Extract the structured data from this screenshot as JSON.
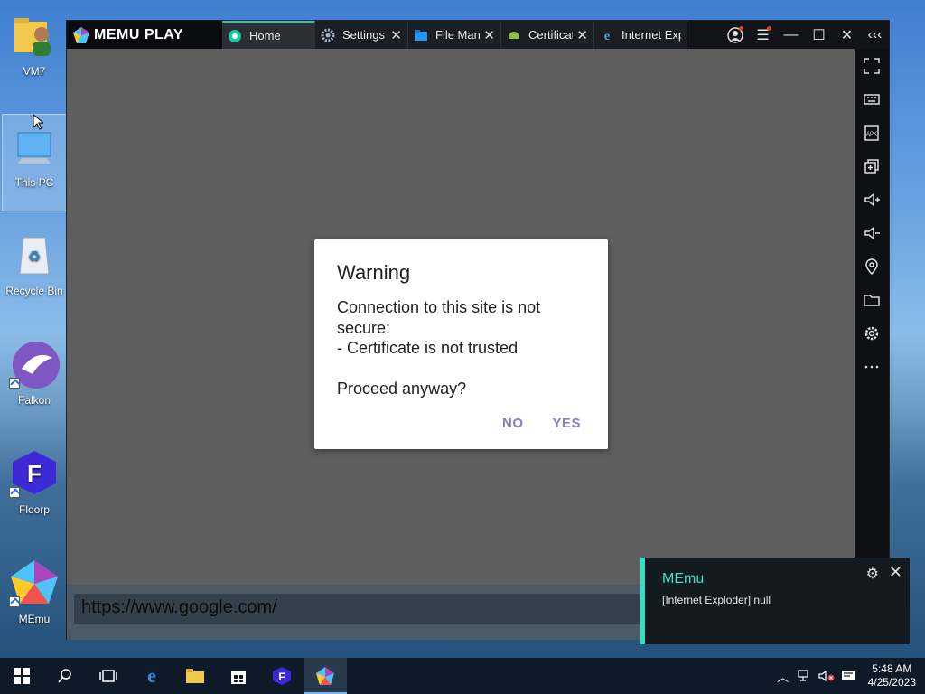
{
  "desktop": {
    "icons": [
      {
        "label": "VM7",
        "icon": "user-folder-icon"
      },
      {
        "label": "This PC",
        "icon": "computer-icon"
      },
      {
        "label": "Recycle Bin",
        "icon": "recycle-bin-icon"
      },
      {
        "label": "Falkon",
        "icon": "falkon-browser-icon"
      },
      {
        "label": "Floorp",
        "icon": "floorp-browser-icon"
      },
      {
        "label": "MEmu",
        "icon": "memu-icon"
      }
    ]
  },
  "window": {
    "brand": "MEMU PLAY",
    "tabs": [
      {
        "label": "Home",
        "icon": "home-app-icon",
        "active": true
      },
      {
        "label": "Settings",
        "icon": "settings-gear-icon"
      },
      {
        "label": "File Manager",
        "icon": "folder-icon"
      },
      {
        "label": "Certificate",
        "icon": "android-icon"
      },
      {
        "label": "Internet Explorer",
        "icon": "internet-explorer-icon"
      }
    ],
    "sidebar": [
      "fullscreen-icon",
      "keyboard-icon",
      "apk-icon",
      "multi-instance-icon",
      "volume-up-icon",
      "volume-down-icon",
      "location-icon",
      "folder-icon",
      "settings-icon",
      "more-icon",
      "back-icon"
    ]
  },
  "url_bar": {
    "value": "https://www.google.com/"
  },
  "dialog": {
    "title": "Warning",
    "message": "Connection to this site is not secure:\n - Certificate is not trusted\n\nProceed anyway?",
    "no_label": "NO",
    "yes_label": "YES"
  },
  "notification": {
    "app": "MEmu",
    "body": "[Internet Exploder] null"
  },
  "taskbar": {
    "time": "5:48 AM",
    "date": "4/25/2023"
  },
  "colors": {
    "accent": "#1ec8a5",
    "dialog_button": "#8e7cc3",
    "screen_bg": "#5e5e5e"
  }
}
